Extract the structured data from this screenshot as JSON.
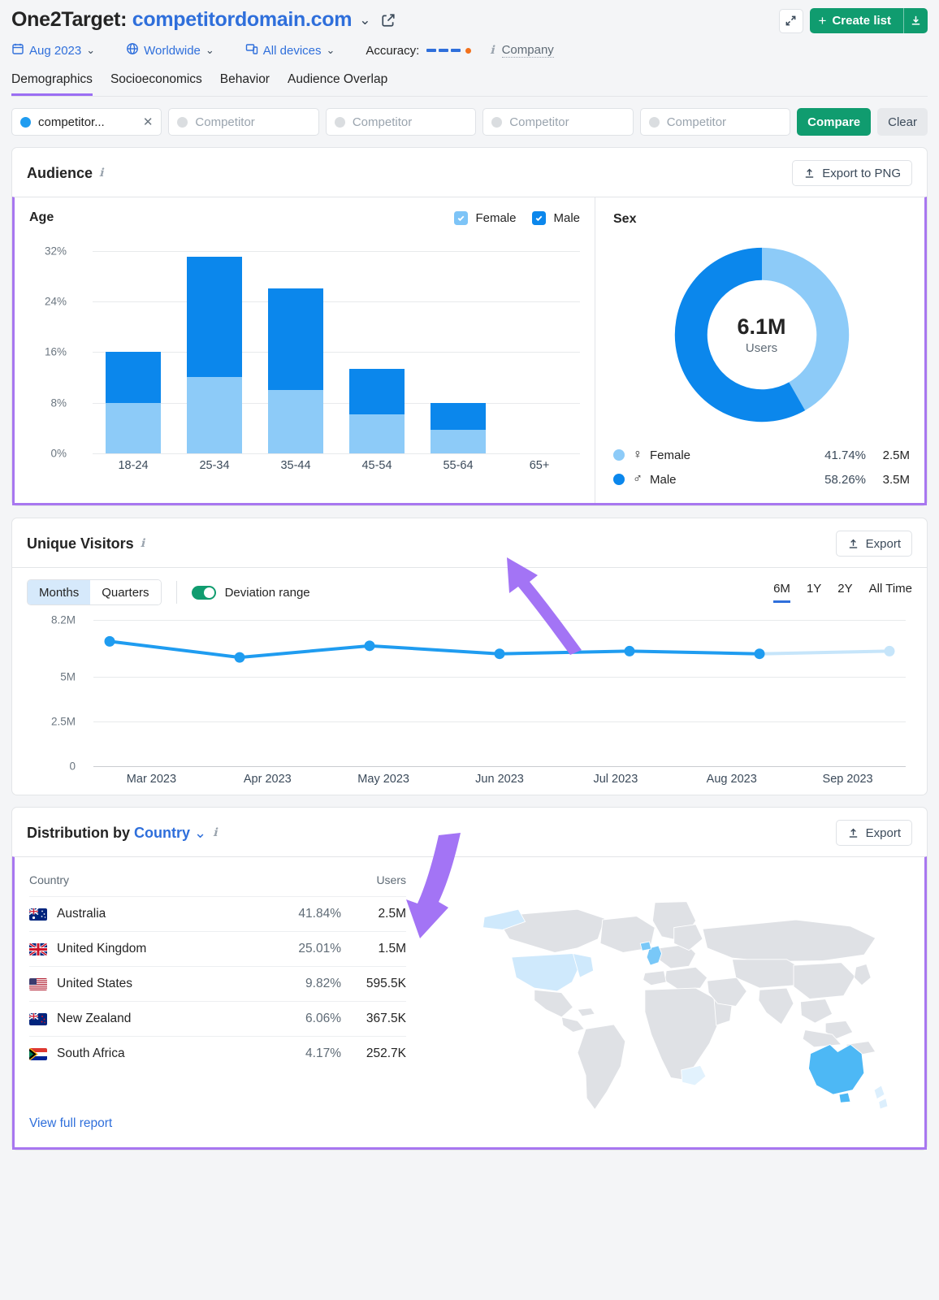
{
  "header": {
    "title_prefix": "One2Target:",
    "domain": "competitordomain.com",
    "chevron": "⌄",
    "external_link_icon": "external-link-icon",
    "expand_icon": "expand-icon",
    "create_list_label": "Create list",
    "create_list_plus": "+",
    "download_icon": "download-icon",
    "filters": [
      {
        "icon": "calendar-icon",
        "label": "Aug 2023"
      },
      {
        "icon": "globe-icon",
        "label": "Worldwide"
      },
      {
        "icon": "devices-icon",
        "label": "All devices"
      }
    ],
    "accuracy_label": "Accuracy:",
    "accuracy_dashes": 3,
    "company_label": "Company"
  },
  "tabs": [
    {
      "label": "Demographics",
      "active": true
    },
    {
      "label": "Socioeconomics",
      "active": false
    },
    {
      "label": "Behavior",
      "active": false
    },
    {
      "label": "Audience Overlap",
      "active": false
    }
  ],
  "competitors": {
    "chips": [
      {
        "value": "competitor...",
        "placeholder": "",
        "filled": true,
        "close": "✕"
      },
      {
        "value": "",
        "placeholder": "Competitor",
        "filled": false
      },
      {
        "value": "",
        "placeholder": "Competitor",
        "filled": false
      },
      {
        "value": "",
        "placeholder": "Competitor",
        "filled": false
      },
      {
        "value": "",
        "placeholder": "Competitor",
        "filled": false
      }
    ],
    "compare_label": "Compare",
    "clear_label": "Clear"
  },
  "audience": {
    "title": "Audience",
    "export_label": "Export to PNG",
    "age_title": "Age",
    "legend": [
      {
        "label": "Female",
        "color": "#7dc4f7",
        "checked": true
      },
      {
        "label": "Male",
        "color": "#0b87ec",
        "checked": true
      }
    ],
    "sex_title": "Sex",
    "donut_center_value": "6.1M",
    "donut_center_sub": "Users",
    "sex_rows": [
      {
        "symbol": "♀",
        "label": "Female",
        "pct": "41.74%",
        "users": "2.5M",
        "color": "#8dcbf8"
      },
      {
        "symbol": "♂",
        "label": "Male",
        "pct": "58.26%",
        "users": "3.5M",
        "color": "#0b87ec"
      }
    ]
  },
  "unique_visitors": {
    "title": "Unique Visitors",
    "export_label": "Export",
    "granularity": [
      {
        "label": "Months",
        "active": true
      },
      {
        "label": "Quarters",
        "active": false
      }
    ],
    "deviation_label": "Deviation range",
    "deviation_on": true,
    "ranges": [
      {
        "label": "6M",
        "active": true
      },
      {
        "label": "1Y",
        "active": false
      },
      {
        "label": "2Y",
        "active": false
      },
      {
        "label": "All Time",
        "active": false
      }
    ]
  },
  "distribution": {
    "title_prefix": "Distribution by",
    "title_dim": "Country",
    "export_label": "Export",
    "columns": {
      "country": "Country",
      "users": "Users"
    },
    "rows": [
      {
        "flag": "au",
        "country": "Australia",
        "pct": "41.84%",
        "users": "2.5M"
      },
      {
        "flag": "gb",
        "country": "United Kingdom",
        "pct": "25.01%",
        "users": "1.5M"
      },
      {
        "flag": "us",
        "country": "United States",
        "pct": "9.82%",
        "users": "595.5K"
      },
      {
        "flag": "nz",
        "country": "New Zealand",
        "pct": "6.06%",
        "users": "367.5K"
      },
      {
        "flag": "za",
        "country": "South Africa",
        "pct": "4.17%",
        "users": "252.7K"
      }
    ],
    "view_full_report": "View full report"
  },
  "chart_data": [
    {
      "type": "bar",
      "title": "Age",
      "stacked": true,
      "categories": [
        "18-24",
        "25-34",
        "35-44",
        "45-54",
        "55-64",
        "65+"
      ],
      "series": [
        {
          "name": "Female",
          "color": "#8dcbf8",
          "values": [
            8.0,
            12.0,
            10.0,
            6.2,
            3.7,
            0
          ]
        },
        {
          "name": "Male",
          "color": "#0b87ec",
          "values": [
            8.0,
            19.0,
            16.0,
            7.1,
            4.3,
            0
          ]
        }
      ],
      "totals": [
        16.0,
        31.0,
        26.0,
        13.3,
        8.0,
        0
      ],
      "ylabel": "",
      "ytick_labels": [
        "0%",
        "8%",
        "16%",
        "24%",
        "32%"
      ],
      "ytick_values": [
        0,
        8,
        16,
        24,
        32
      ],
      "ylim": [
        0,
        34
      ],
      "grid": true
    },
    {
      "type": "pie",
      "title": "Sex",
      "donut": true,
      "labels": [
        "Female",
        "Male"
      ],
      "values": [
        41.74,
        58.26
      ],
      "value_users": [
        "2.5M",
        "3.5M"
      ],
      "colors": [
        "#8dcbf8",
        "#0b87ec"
      ],
      "center_label": "6.1M",
      "center_sub": "Users"
    },
    {
      "type": "line",
      "title": "Unique Visitors",
      "x": [
        "Mar 2023",
        "Apr 2023",
        "May 2023",
        "Jun 2023",
        "Jul 2023",
        "Aug 2023",
        "Sep 2023"
      ],
      "series": [
        {
          "name": "Unique Visitors",
          "color": "#1f9cf0",
          "values": [
            7.0,
            6.1,
            6.75,
            6.3,
            6.45,
            6.3,
            6.45
          ]
        }
      ],
      "forecast_from_index": 5,
      "ylabel": "",
      "ytick_labels": [
        "0",
        "2.5M",
        "5M",
        "8.2M"
      ],
      "ytick_values": [
        0,
        2.5,
        5,
        8.2
      ],
      "ylim": [
        0,
        8.2
      ],
      "grid": true
    },
    {
      "type": "heatmap",
      "title": "Distribution by Country",
      "map": "world-choropleth",
      "regions": [
        {
          "name": "Australia",
          "value": 41.84,
          "color": "#4db8f5"
        },
        {
          "name": "United Kingdom",
          "value": 25.01,
          "color": "#79c8f8"
        },
        {
          "name": "United States",
          "value": 9.82,
          "color": "#cfe9fc"
        },
        {
          "name": "New Zealand",
          "value": 6.06,
          "color": "#dceffd"
        },
        {
          "name": "South Africa",
          "value": 4.17,
          "color": "#e2f2fd"
        }
      ],
      "base_color": "#dfe1e5"
    }
  ],
  "annotations": {
    "color": "#a374f5",
    "arrows": [
      "arrow-to-audience-chart",
      "arrow-to-country-distribution"
    ]
  }
}
